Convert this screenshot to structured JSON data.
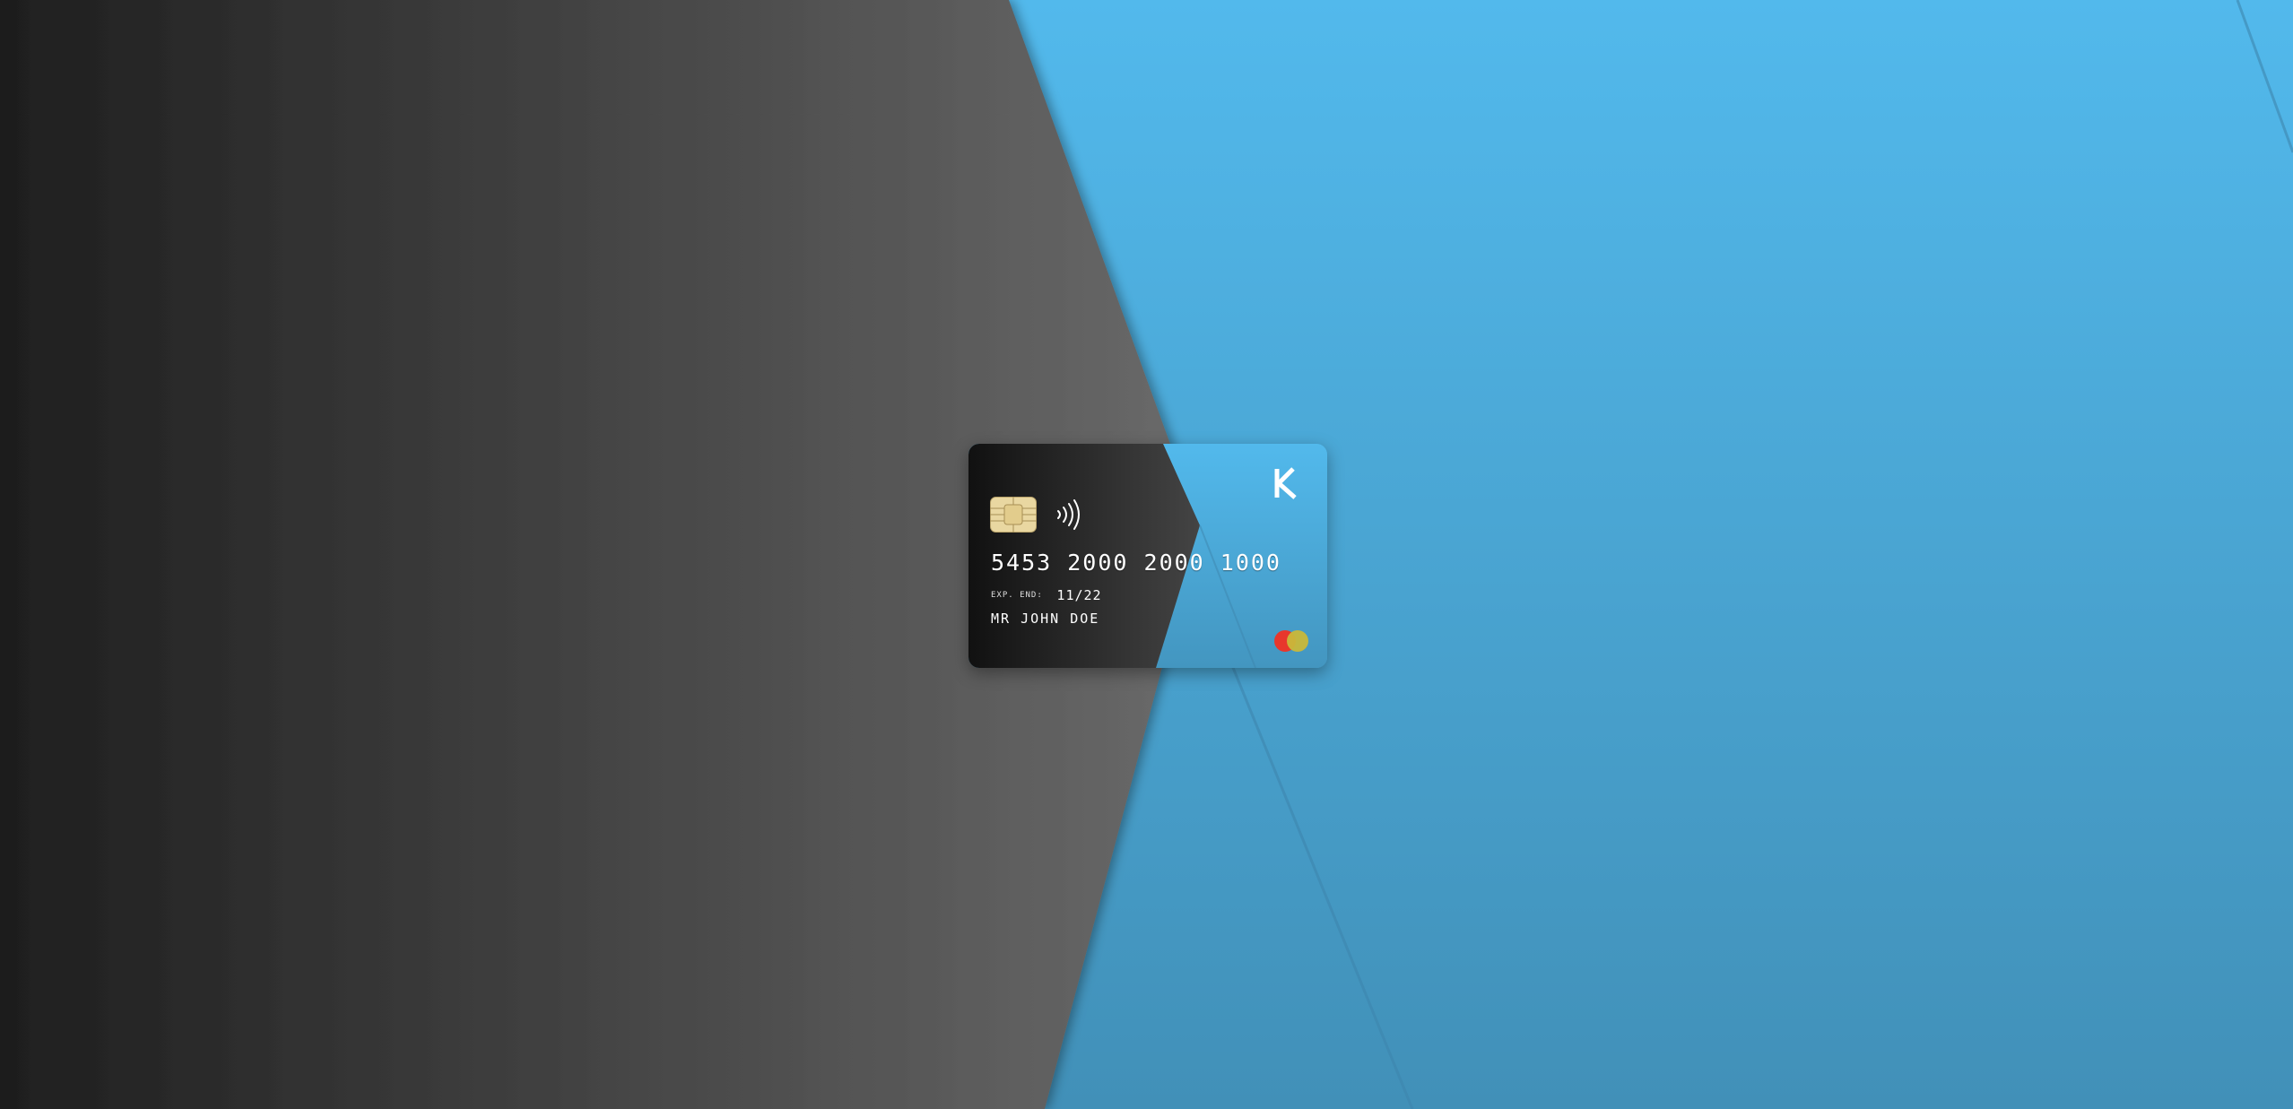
{
  "colors": {
    "dark_left": "#1e1e1e",
    "dark_right": "#6a6a6a",
    "blue_top": "#52b9ec",
    "blue_bottom": "#4190b8",
    "card_dark": "#111111",
    "card_blue": "#4fb4e8",
    "chip_gold": "#e9d7a1",
    "mc_red": "#e8372c",
    "mc_yellow": "#c9b83a"
  },
  "card": {
    "number": "5453 2000 2000 1000",
    "expiry_label": "EXP. END:",
    "expiry_value": "11/22",
    "holder_name": "MR JOHN DOE",
    "brand_letter": "K",
    "chip_icon": "emv-chip-icon",
    "contactless_icon": "contactless-icon",
    "network_icon": "mastercard-logo-icon"
  }
}
